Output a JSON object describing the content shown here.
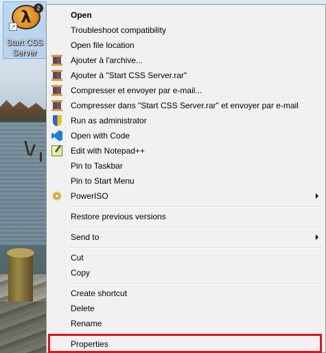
{
  "desktop": {
    "shortcut": {
      "label_line1": "Start CSS",
      "label_line2": "Server",
      "logo_glyph": "λ",
      "logo_badge": "2",
      "icon": "half-life-2-icon"
    }
  },
  "context_menu": {
    "items": [
      {
        "label": "Open",
        "bold": true
      },
      {
        "label": "Troubleshoot compatibility"
      },
      {
        "label": "Open file location"
      },
      {
        "label": "Ajouter à l'archive...",
        "icon": "winrar-icon"
      },
      {
        "label": "Ajouter à \"Start CSS Server.rar\"",
        "icon": "winrar-icon"
      },
      {
        "label": "Compresser et envoyer par e-mail...",
        "icon": "winrar-icon"
      },
      {
        "label": "Compresser dans \"Start CSS Server.rar\" et envoyer par e-mail",
        "icon": "winrar-icon"
      },
      {
        "label": "Run as administrator",
        "icon": "uac-shield-icon"
      },
      {
        "label": "Open with Code",
        "icon": "vscode-icon"
      },
      {
        "label": "Edit with Notepad++",
        "icon": "notepadpp-icon"
      },
      {
        "label": "Pin to Taskbar"
      },
      {
        "label": "Pin to Start Menu"
      },
      {
        "label": "PowerISO",
        "icon": "poweriso-icon",
        "submenu": true
      },
      {
        "label": "Restore previous versions"
      },
      {
        "label": "Send to",
        "submenu": true
      },
      {
        "label": "Cut"
      },
      {
        "label": "Copy"
      },
      {
        "label": "Create shortcut"
      },
      {
        "label": "Delete"
      },
      {
        "label": "Rename"
      },
      {
        "label": "Properties",
        "highlighted_with_red_box": true
      }
    ]
  },
  "colors": {
    "menu_background": "#f1f1f1",
    "highlight_box": "#e0101a"
  }
}
